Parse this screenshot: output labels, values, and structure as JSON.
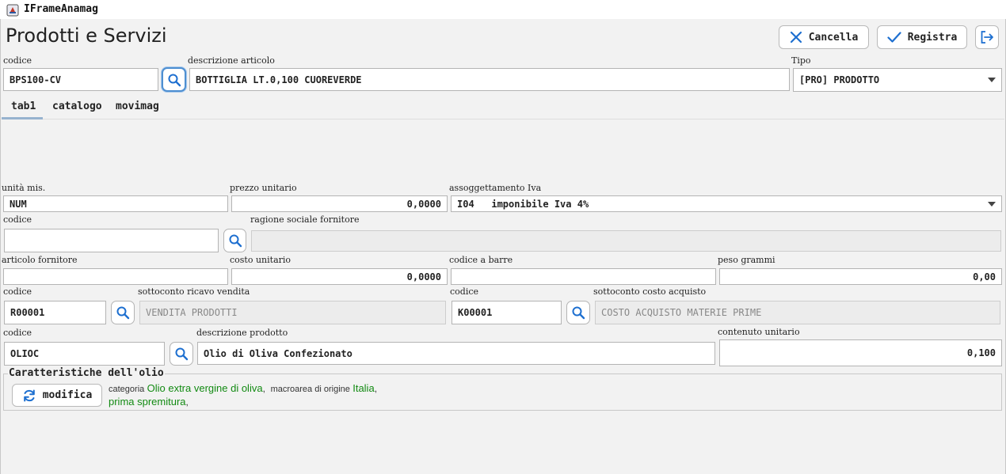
{
  "window": {
    "title": "IFrameAnamag"
  },
  "page": {
    "title": "Prodotti e Servizi"
  },
  "toolbar": {
    "cancel_label": "Cancella",
    "save_label": "Registra"
  },
  "header": {
    "codice_label": "codice",
    "codice_value": "BPS100-CV",
    "descrizione_label": "descrizione articolo",
    "descrizione_value": "BOTTIGLIA LT.0,100 CUOREVERDE",
    "tipo_label": "Tipo",
    "tipo_value": "[PRO] PRODOTTO"
  },
  "tabs": [
    {
      "label": "tab1",
      "active": true
    },
    {
      "label": "catalogo",
      "active": false
    },
    {
      "label": "movimag",
      "active": false
    }
  ],
  "form": {
    "unita_label": "unità mis.",
    "unita_value": "NUM",
    "prezzo_label": "prezzo unitario",
    "prezzo_value": "0,0000",
    "iva_label": "assoggettamento Iva",
    "iva_value": "I04   imponibile Iva 4%",
    "fornitore_codice_label": "codice",
    "fornitore_codice_value": "",
    "ragione_label": "ragione sociale fornitore",
    "ragione_value": "",
    "articolo_fornitore_label": "articolo fornitore",
    "articolo_fornitore_value": "",
    "costo_label": "costo unitario",
    "costo_value": "0,0000",
    "barre_label": "codice a barre",
    "barre_value": "",
    "peso_label": "peso grammi",
    "peso_value": "0,00",
    "ricavo_codice_label": "codice",
    "ricavo_codice_value": "R00001",
    "ricavo_desc_label": "sottoconto ricavo vendita",
    "ricavo_desc_value": "VENDITA PRODOTTI",
    "costo_codice_label": "codice",
    "costo_codice_value": "K00001",
    "costo_desc_label": "sottoconto costo acquisto",
    "costo_desc_value": "COSTO ACQUISTO MATERIE PRIME",
    "prodotto_codice_label": "codice",
    "prodotto_codice_value": "OLIOC",
    "prodotto_desc_label": "descrizione prodotto",
    "prodotto_desc_value": "Olio di Oliva Confezionato",
    "contenuto_label": "contenuto unitario",
    "contenuto_value": "0,100"
  },
  "olio": {
    "group_title": "Caratteristiche dell'olio",
    "modifica_label": "modifica",
    "categoria_label": "categoria",
    "categoria_value": "Olio extra vergine di oliva",
    "macroarea_label": "macroarea di origine",
    "macroarea_value": "Italia",
    "spremitura_value": "prima spremitura",
    "sep": ","
  },
  "colors": {
    "accent_green": "#128a12",
    "focus_blue": "#4e8fd1",
    "search_icon_blue": "#1d6fd0",
    "exit_icon_blue": "#1d6fd0"
  },
  "icons": [
    "app-icon",
    "close-icon",
    "check-icon",
    "exit-icon",
    "search-icon",
    "refresh-icon",
    "chevron-down-icon"
  ]
}
